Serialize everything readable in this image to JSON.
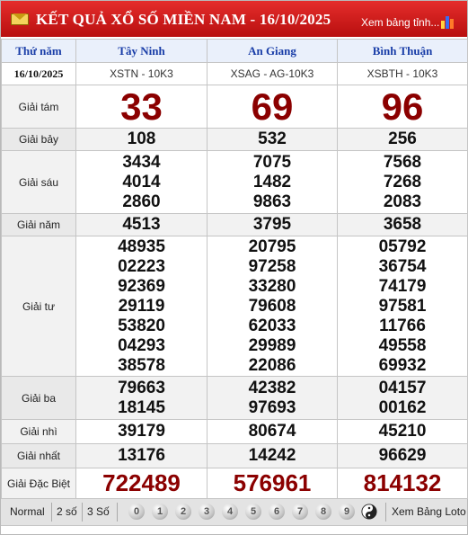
{
  "header": {
    "title": "KẾT QUẢ XỔ SỐ MIỀN NAM - 16/10/2025",
    "link": "Xem bảng tỉnh..."
  },
  "columns": {
    "weekday_label": "Thứ năm",
    "date": "16/10/2025",
    "provinces": [
      {
        "name": "Tây Ninh",
        "code": "XSTN - 10K3"
      },
      {
        "name": "An Giang",
        "code": "XSAG - AG-10K3"
      },
      {
        "name": "Bình Thuận",
        "code": "XSBTH - 10K3"
      }
    ]
  },
  "prizes": [
    {
      "label": "Giải tám",
      "results": [
        [
          "33"
        ],
        [
          "69"
        ],
        [
          "96"
        ]
      ]
    },
    {
      "label": "Giải bảy",
      "results": [
        [
          "108"
        ],
        [
          "532"
        ],
        [
          "256"
        ]
      ]
    },
    {
      "label": "Giải sáu",
      "results": [
        [
          "3434",
          "4014",
          "2860"
        ],
        [
          "7075",
          "1482",
          "9863"
        ],
        [
          "7568",
          "7268",
          "2083"
        ]
      ]
    },
    {
      "label": "Giải năm",
      "results": [
        [
          "4513"
        ],
        [
          "3795"
        ],
        [
          "3658"
        ]
      ]
    },
    {
      "label": "Giải tư",
      "results": [
        [
          "48935",
          "02223",
          "92369",
          "29119",
          "53820",
          "04293",
          "38578"
        ],
        [
          "20795",
          "97258",
          "33280",
          "79608",
          "62033",
          "29989",
          "22086"
        ],
        [
          "05792",
          "36754",
          "74179",
          "97581",
          "11766",
          "49558",
          "69932"
        ]
      ]
    },
    {
      "label": "Giải ba",
      "results": [
        [
          "79663",
          "18145"
        ],
        [
          "42382",
          "97693"
        ],
        [
          "04157",
          "00162"
        ]
      ]
    },
    {
      "label": "Giải nhì",
      "results": [
        [
          "39179"
        ],
        [
          "80674"
        ],
        [
          "45210"
        ]
      ]
    },
    {
      "label": "Giải nhất",
      "results": [
        [
          "13176"
        ],
        [
          "14242"
        ],
        [
          "96629"
        ]
      ]
    },
    {
      "label": "Giải Đặc Biệt",
      "results": [
        [
          "722489"
        ],
        [
          "576961"
        ],
        [
          "814132"
        ]
      ]
    }
  ],
  "footer": {
    "modes": [
      "Normal",
      "2 số",
      "3 Số"
    ],
    "digits": [
      "0",
      "1",
      "2",
      "3",
      "4",
      "5",
      "6",
      "7",
      "8",
      "9"
    ],
    "link": "Xem Bảng Loto"
  },
  "colors": {
    "header_red": "#d01d1d",
    "prize_red": "#8b0000",
    "province_blue": "#1a3ea8"
  },
  "icons": {
    "mail": "mail-icon",
    "chart": "bar-chart-icon",
    "yin_yang": "yin-yang-icon"
  }
}
